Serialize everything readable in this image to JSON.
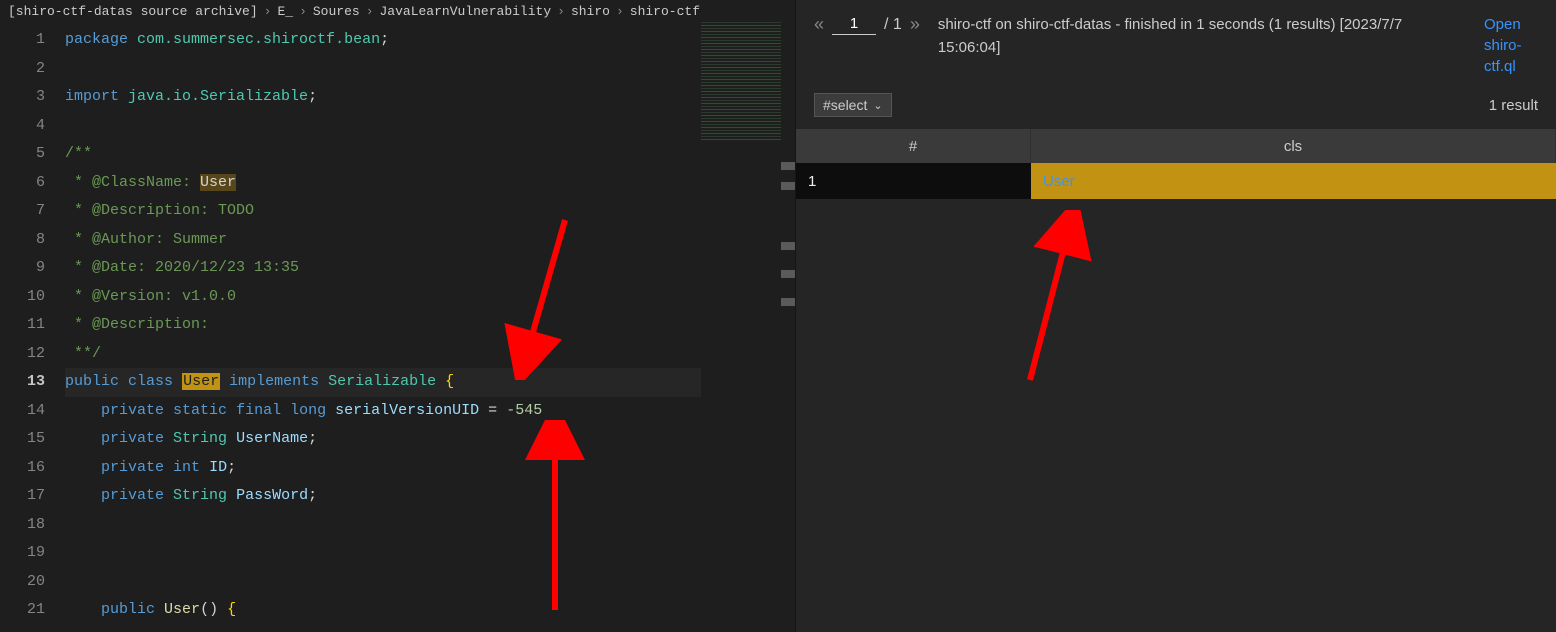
{
  "breadcrumb": [
    "[shiro-ctf-datas source archive]",
    "E_",
    "Soures",
    "JavaLearnVulnerability",
    "shiro",
    "shiro-ctf"
  ],
  "code": {
    "lines": [
      {
        "n": 1,
        "tokens": [
          [
            "k-blue",
            "package"
          ],
          [
            "k-white",
            " "
          ],
          [
            "k-teal",
            "com.summersec.shiroctf.bean"
          ],
          [
            "k-white",
            ";"
          ]
        ]
      },
      {
        "n": 2,
        "tokens": []
      },
      {
        "n": 3,
        "tokens": [
          [
            "k-blue",
            "import"
          ],
          [
            "k-white",
            " "
          ],
          [
            "k-teal",
            "java.io.Serializable"
          ],
          [
            "k-white",
            ";"
          ]
        ]
      },
      {
        "n": 4,
        "tokens": []
      },
      {
        "n": 5,
        "tokens": [
          [
            "k-green",
            "/**"
          ]
        ]
      },
      {
        "n": 6,
        "tokens": [
          [
            "k-green",
            " * @ClassName: "
          ],
          [
            "hl-dim",
            "User"
          ]
        ]
      },
      {
        "n": 7,
        "tokens": [
          [
            "k-green",
            " * @Description: TODO"
          ]
        ]
      },
      {
        "n": 8,
        "tokens": [
          [
            "k-green",
            " * @Author: Summer"
          ]
        ]
      },
      {
        "n": 9,
        "tokens": [
          [
            "k-green",
            " * @Date: 2020/12/23 13:35"
          ]
        ]
      },
      {
        "n": 10,
        "tokens": [
          [
            "k-green",
            " * @Version: v1.0.0"
          ]
        ]
      },
      {
        "n": 11,
        "tokens": [
          [
            "k-green",
            " * @Description:"
          ]
        ]
      },
      {
        "n": 12,
        "tokens": [
          [
            "k-green",
            " **/"
          ]
        ]
      },
      {
        "n": 13,
        "active": true,
        "tokens": [
          [
            "k-blue",
            "public"
          ],
          [
            "k-white",
            " "
          ],
          [
            "k-blue",
            "class"
          ],
          [
            "k-white",
            " "
          ],
          [
            "hl",
            "User"
          ],
          [
            "k-white",
            " "
          ],
          [
            "k-blue",
            "implements"
          ],
          [
            "k-white",
            " "
          ],
          [
            "k-teal",
            "Serializable"
          ],
          [
            "k-white",
            " "
          ],
          [
            "k-bracket",
            "{"
          ]
        ]
      },
      {
        "n": 14,
        "indent": "    ",
        "tokens": [
          [
            "k-blue",
            "private"
          ],
          [
            "k-white",
            " "
          ],
          [
            "k-blue",
            "static"
          ],
          [
            "k-white",
            " "
          ],
          [
            "k-blue",
            "final"
          ],
          [
            "k-white",
            " "
          ],
          [
            "k-blue",
            "long"
          ],
          [
            "k-white",
            " "
          ],
          [
            "k-lightblue",
            "serialVersionUID"
          ],
          [
            "k-white",
            " = "
          ],
          [
            "k-num",
            "-545"
          ]
        ]
      },
      {
        "n": 15,
        "indent": "    ",
        "tokens": [
          [
            "k-blue",
            "private"
          ],
          [
            "k-white",
            " "
          ],
          [
            "k-teal",
            "String"
          ],
          [
            "k-white",
            " "
          ],
          [
            "k-lightblue",
            "UserName"
          ],
          [
            "k-white",
            ";"
          ]
        ]
      },
      {
        "n": 16,
        "indent": "    ",
        "tokens": [
          [
            "k-blue",
            "private"
          ],
          [
            "k-white",
            " "
          ],
          [
            "k-blue",
            "int"
          ],
          [
            "k-white",
            " "
          ],
          [
            "k-lightblue",
            "ID"
          ],
          [
            "k-white",
            ";"
          ]
        ]
      },
      {
        "n": 17,
        "indent": "    ",
        "tokens": [
          [
            "k-blue",
            "private"
          ],
          [
            "k-white",
            " "
          ],
          [
            "k-teal",
            "String"
          ],
          [
            "k-white",
            " "
          ],
          [
            "k-lightblue",
            "PassWord"
          ],
          [
            "k-white",
            ";"
          ]
        ]
      },
      {
        "n": 18,
        "tokens": []
      },
      {
        "n": 19,
        "tokens": []
      },
      {
        "n": 20,
        "tokens": []
      },
      {
        "n": 21,
        "indent": "    ",
        "tokens": [
          [
            "k-blue",
            "public"
          ],
          [
            "k-white",
            " "
          ],
          [
            "k-yellow",
            "User"
          ],
          [
            "k-white",
            "() "
          ],
          [
            "k-bracket",
            "{"
          ]
        ]
      }
    ]
  },
  "results": {
    "pager": {
      "prev": "«",
      "next": "»",
      "page": "1",
      "total": "/ 1"
    },
    "title": "shiro-ctf on shiro-ctf-datas - finished in 1 seconds (1 results) [2023/7/7 15:06:04]",
    "openLink": "Open shiro-ctf.ql",
    "selectLabel": "#select",
    "countLabel": "1 result",
    "columns": {
      "idx": "#",
      "cls": "cls"
    },
    "rows": [
      {
        "idx": "1",
        "cls": "User"
      }
    ]
  }
}
